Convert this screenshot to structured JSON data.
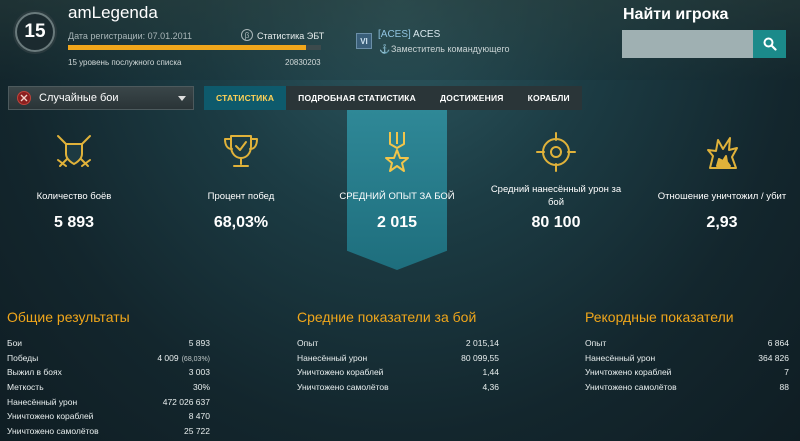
{
  "player": {
    "level": "15",
    "name": "amLegenda",
    "reg_date": "Дата регистрации: 07.01.2011",
    "ebt_icon": "β",
    "ebt_link": "Статистика ЭБТ",
    "rank": "15 уровень послужного списка",
    "points": "20830203",
    "progress": 0.94
  },
  "clan": {
    "emblem": "VI",
    "tag": "[ACES]",
    "name": "ACES",
    "role_icon": "⚓",
    "role": "Заместитель командующего"
  },
  "search": {
    "title": "Найти игрока",
    "value": "",
    "icon": "search-icon"
  },
  "mode": {
    "label": "Случайные бои",
    "icon": "random-battle-icon"
  },
  "tabs": [
    {
      "label": "СТАТИСТИКА",
      "active": true
    },
    {
      "label": "ПОДРОБНАЯ СТАТИСТИКА",
      "active": false
    },
    {
      "label": "ДОСТИЖЕНИЯ",
      "active": false
    },
    {
      "label": "КОРАБЛИ",
      "active": false
    }
  ],
  "highlights": [
    {
      "icon": "swords-shield-icon",
      "label": "Количество боёв",
      "value": "5 893"
    },
    {
      "icon": "trophy-cup-icon",
      "label": "Процент побед",
      "value": "68,03%"
    },
    {
      "icon": "medal-star-icon",
      "label": "СРЕДНИЙ ОПЫТ ЗА БОЙ",
      "value": "2 015"
    },
    {
      "icon": "crosshair-icon",
      "label": "Средний нанесённый урон за бой",
      "value": "80 100"
    },
    {
      "icon": "explosion-icon",
      "label": "Отношение уничтожил / убит",
      "value": "2,93"
    }
  ],
  "colors": {
    "accent": "#f0a61b",
    "active_tab_bg": "#0e5a6c",
    "highlight_bg": "#2f8897"
  },
  "general": {
    "title": "Общие результаты",
    "rows": [
      {
        "label": "Бои",
        "value": "5 893",
        "extra": ""
      },
      {
        "label": "Победы",
        "value": "4 009",
        "extra": "(68,03%)"
      },
      {
        "label": "Выжил в боях",
        "value": "3 003",
        "extra": ""
      },
      {
        "label": "Меткость",
        "value": "30%",
        "extra": ""
      },
      {
        "label": "Нанесённый урон",
        "value": "472 026 637",
        "extra": ""
      },
      {
        "label": "Уничтожено кораблей",
        "value": "8 470",
        "extra": ""
      },
      {
        "label": "Уничтожено самолётов",
        "value": "25 722",
        "extra": ""
      }
    ]
  },
  "averages": {
    "title": "Средние показатели за бой",
    "rows": [
      {
        "label": "Опыт",
        "value": "2 015,14"
      },
      {
        "label": "Нанесённый урон",
        "value": "80 099,55"
      },
      {
        "label": "Уничтожено кораблей",
        "value": "1,44"
      },
      {
        "label": "Уничтожено самолётов",
        "value": "4,36"
      }
    ]
  },
  "records": {
    "title": "Рекордные показатели",
    "rows": [
      {
        "label": "Опыт",
        "value": "6 864"
      },
      {
        "label": "Нанесённый урон",
        "value": "364 826"
      },
      {
        "label": "Уничтожено кораблей",
        "value": "7"
      },
      {
        "label": "Уничтожено самолётов",
        "value": "88"
      }
    ]
  }
}
